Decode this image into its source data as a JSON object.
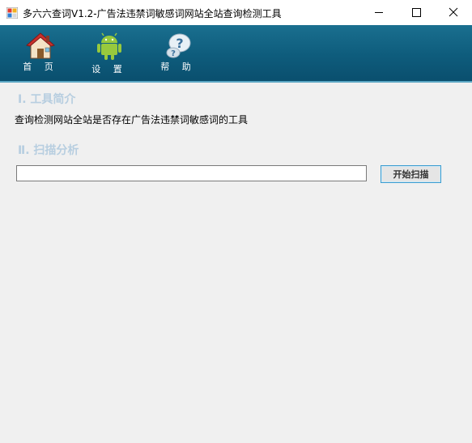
{
  "window": {
    "title": "多六六查词V1.2-广告法违禁词敏感词网站全站查询检测工具",
    "app_icon": "app-icon",
    "controls": [
      "minimize-icon",
      "maximize-icon",
      "close-icon"
    ]
  },
  "toolbar": {
    "items": [
      {
        "label": "首 页",
        "icon": "home-icon"
      },
      {
        "label": "设 置",
        "icon": "android-icon"
      },
      {
        "label": "帮 助",
        "icon": "help-icon"
      }
    ],
    "colors": {
      "background": "#0e5c7c",
      "text": "#ffffff"
    }
  },
  "sections": [
    {
      "title": "Ⅰ. 工具简介",
      "description": "查询检测网站全站是否存在广告法违禁词敏感词的工具"
    },
    {
      "title": "Ⅱ. 扫描分析"
    }
  ],
  "scan": {
    "url_value": "",
    "url_placeholder": "",
    "button_label": "开始扫描"
  },
  "colors": {
    "section_title": "#b7cee0",
    "button_border": "#3c9dd0"
  }
}
